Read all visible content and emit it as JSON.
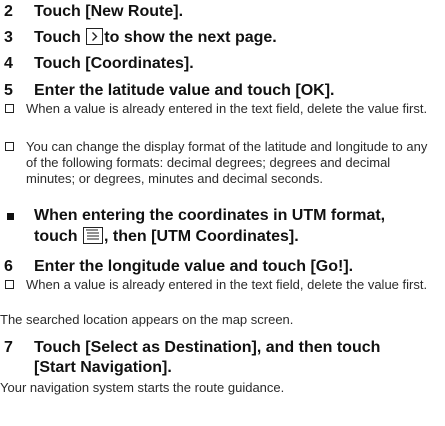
{
  "steps": [
    {
      "num": "2",
      "text": "Touch [New Route]."
    },
    {
      "num": "3",
      "pre": "Touch",
      "post": "to show the next page.",
      "icon": "next-page-arrow-icon"
    },
    {
      "num": "4",
      "text": "Touch [Coordinates]."
    },
    {
      "num": "5",
      "text": "Enter the latitude value and touch [OK]."
    }
  ],
  "step5_notes": [
    "When a value is already entered in the text field, delete the value first.",
    "You can change the display format of the latitude and longitude to any of the following formats: decimal degrees; degrees and decimal minutes; or degrees, minutes and decimal seconds."
  ],
  "utm": {
    "line1": "When entering the coordinates in UTM format,",
    "pre": "touch",
    "post": ", then [UTM Coordinates].",
    "icon": "menu-list-icon"
  },
  "step6": {
    "num": "6",
    "text": "Enter the longitude value and touch [Go!]."
  },
  "step6_note": "When a value is already entered in the text field, delete the value first.",
  "step6_after": "The searched location appears on the map screen.",
  "step7": {
    "num": "7",
    "line1": "Touch [Select as Destination], and then touch",
    "line2": "[Start Navigation]."
  },
  "step7_after": "Your navigation system starts the route guidance."
}
